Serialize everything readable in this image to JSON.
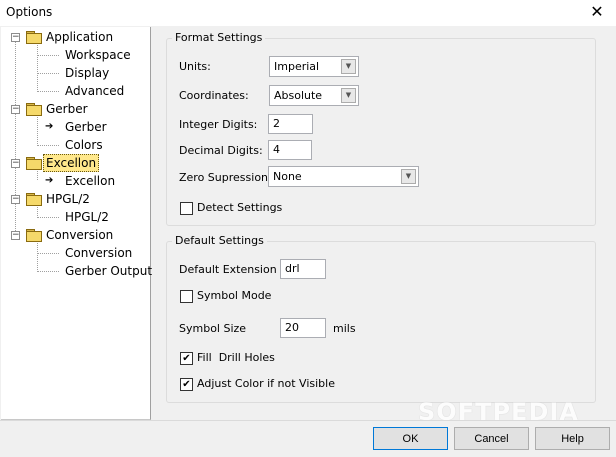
{
  "window": {
    "title": "Options"
  },
  "tree": {
    "application": {
      "label": "Application",
      "children": [
        "Workspace",
        "Display",
        "Advanced"
      ]
    },
    "gerber": {
      "label": "Gerber",
      "children": [
        "Gerber",
        "Colors"
      ]
    },
    "excellon": {
      "label": "Excellon",
      "children": [
        "Excellon"
      ]
    },
    "hpgl": {
      "label": "HPGL/2",
      "children": [
        "HPGL/2"
      ]
    },
    "conversion": {
      "label": "Conversion",
      "children": [
        "Conversion",
        "Gerber Output"
      ]
    }
  },
  "format_settings": {
    "title": "Format Settings",
    "units_label": "Units:",
    "units_value": "Imperial",
    "coordinates_label": "Coordinates:",
    "coordinates_value": "Absolute",
    "integer_digits_label": "Integer Digits:",
    "integer_digits_value": "2",
    "decimal_digits_label": "Decimal Digits:",
    "decimal_digits_value": "4",
    "zero_suppression_label": "Zero Supression:",
    "zero_suppression_value": "None",
    "detect_settings_label": "Detect Settings",
    "detect_settings_checked": false
  },
  "default_settings": {
    "title": "Default Settings",
    "default_extension_label": "Default Extension",
    "default_extension_value": "drl",
    "symbol_mode_label": "Symbol Mode",
    "symbol_mode_checked": false,
    "symbol_size_label": "Symbol Size",
    "symbol_size_value": "20",
    "symbol_size_unit": "mils",
    "fill_drill_holes_label": "Fill  Drill Holes",
    "fill_drill_holes_checked": true,
    "adjust_color_label": "Adjust Color if not Visible",
    "adjust_color_checked": true
  },
  "buttons": {
    "ok": "OK",
    "cancel": "Cancel",
    "help": "Help"
  },
  "watermark": "SOFTPEDIA",
  "colors": {
    "selection": "#ffe88c",
    "default_button_border": "#0078d7"
  }
}
